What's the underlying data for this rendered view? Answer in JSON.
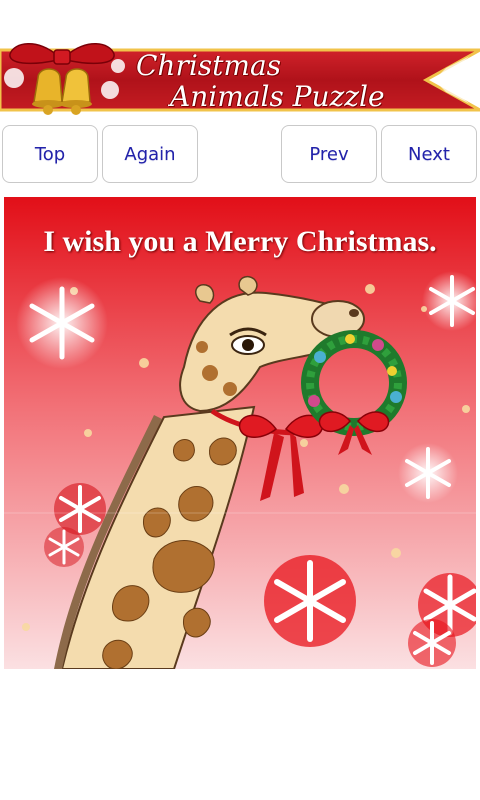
{
  "app": {
    "title_line1": "Christmas",
    "title_line2": "Animals Puzzle"
  },
  "toolbar": {
    "top_label": "Top",
    "again_label": "Again",
    "prev_label": "Prev",
    "next_label": "Next"
  },
  "card": {
    "greeting": "I wish you a Merry Christmas."
  },
  "colors": {
    "banner_red": "#b8141c",
    "banner_gold": "#f0c040",
    "button_text": "#2222aa",
    "card_red": "#e8141c"
  },
  "icons": [
    "bells-icon",
    "snowflake-icon",
    "giraffe-illustration",
    "wreath-icon"
  ]
}
